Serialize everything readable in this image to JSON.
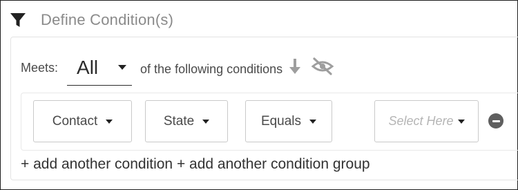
{
  "header": {
    "title": "Define Condition(s)",
    "icon": "filter-icon"
  },
  "meets": {
    "label": "Meets:",
    "value": "All",
    "suffix": "of the following conditions",
    "sort_icon": "sort-down-icon",
    "visibility_icon": "eye-slash-icon"
  },
  "condition": {
    "field1": "Contact",
    "field2": "State",
    "operator": "Equals",
    "value_placeholder": "Select Here",
    "remove_icon": "minus-circle-icon"
  },
  "actions": {
    "add_condition": "+ add another condition",
    "add_group": "+ add another condition group"
  },
  "colors": {
    "title": "#8a8a8a",
    "text": "#333333",
    "placeholder": "#b5b5b5",
    "icon_gray": "#9e9e9e"
  }
}
